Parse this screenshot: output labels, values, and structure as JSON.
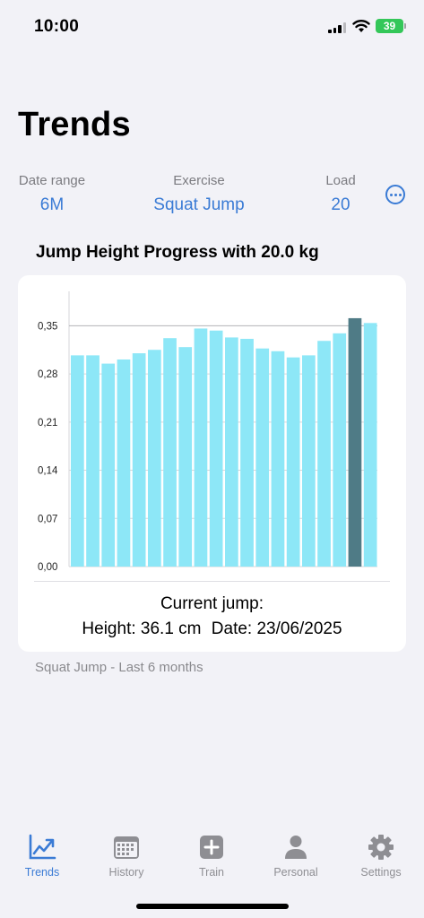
{
  "status_bar": {
    "time": "10:00",
    "battery": "39"
  },
  "page": {
    "title": "Trends"
  },
  "filters": {
    "date_range": {
      "label": "Date range",
      "value": "6M"
    },
    "exercise": {
      "label": "Exercise",
      "value": "Squat Jump"
    },
    "load": {
      "label": "Load",
      "value": "20"
    }
  },
  "chart": {
    "title": "Jump Height Progress with 20.0 kg"
  },
  "chart_data": {
    "type": "bar",
    "title": "Jump Height Progress with 20.0 kg",
    "xlabel": "",
    "ylabel": "",
    "ylim": [
      0,
      0.4
    ],
    "yticks": [
      "0,00",
      "0,07",
      "0,14",
      "0,21",
      "0,28",
      "0,35"
    ],
    "ytick_values": [
      0,
      0.07,
      0.14,
      0.21,
      0.28,
      0.35
    ],
    "values": [
      0.307,
      0.307,
      0.295,
      0.301,
      0.31,
      0.315,
      0.332,
      0.319,
      0.346,
      0.343,
      0.333,
      0.331,
      0.317,
      0.313,
      0.304,
      0.307,
      0.328,
      0.339,
      0.361,
      0.354
    ],
    "highlight_index": 18,
    "colors": {
      "bar": "#8de7f7",
      "highlight": "#4f7b86",
      "grid": "#d6d6d9",
      "reference_line": "#b3b3b7"
    },
    "grid": true
  },
  "current_jump": {
    "title": "Current jump:",
    "height": "Height: 36.1 cm",
    "date": "Date: 23/06/2025"
  },
  "caption": "Squat Jump - Last 6 months",
  "tabs": [
    {
      "label": "Trends",
      "icon": "trends-chart-icon",
      "active": true
    },
    {
      "label": "History",
      "icon": "calendar-icon",
      "active": false
    },
    {
      "label": "Train",
      "icon": "plus-square-icon",
      "active": false
    },
    {
      "label": "Personal",
      "icon": "person-icon",
      "active": false
    },
    {
      "label": "Settings",
      "icon": "gear-icon",
      "active": false
    }
  ],
  "colors": {
    "accent": "#3a7bd5",
    "background": "#f2f2f7",
    "battery": "#34c759"
  }
}
